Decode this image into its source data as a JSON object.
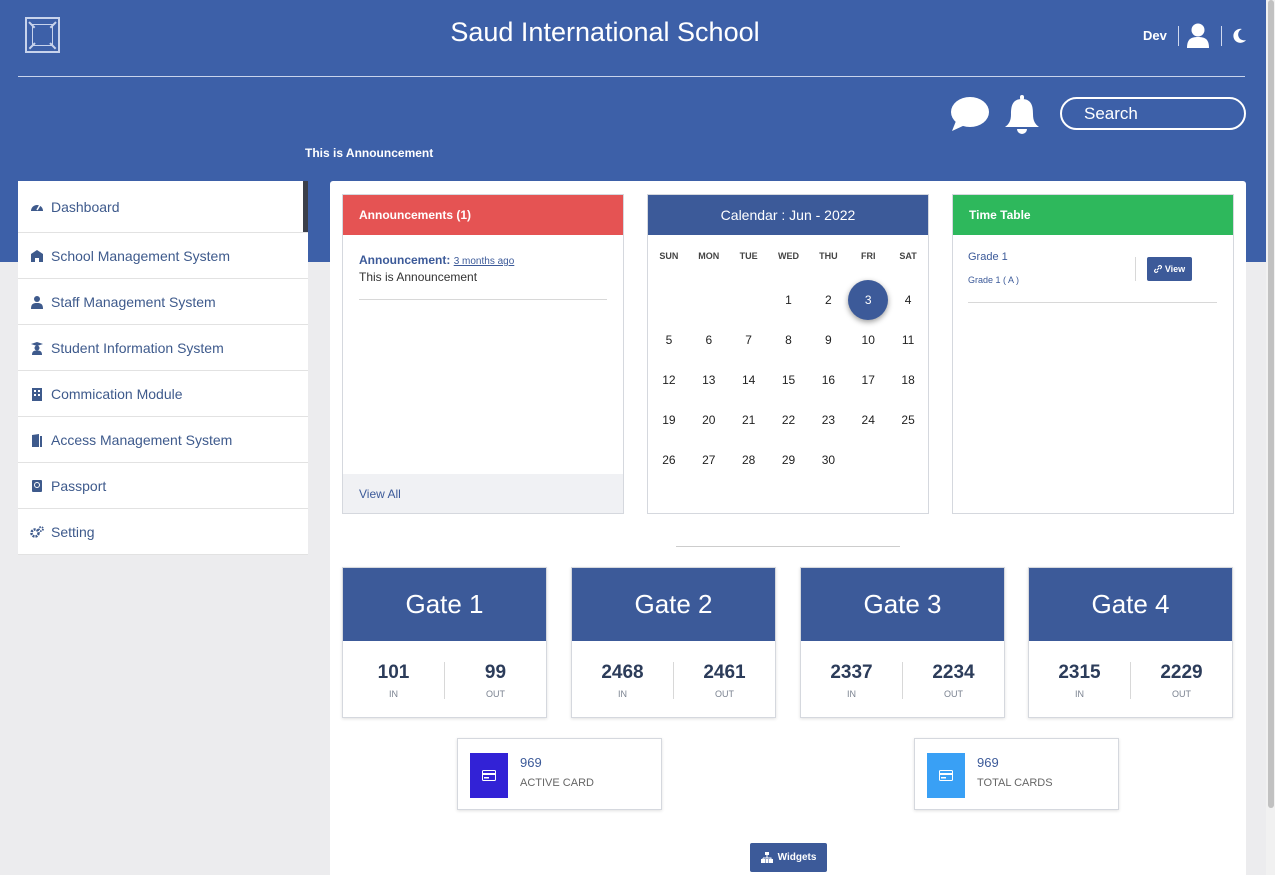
{
  "header": {
    "title": "Saud International School",
    "user_name": "Dev",
    "search_placeholder": "Search",
    "announcement_text": "This is Announcement",
    "icons": [
      "logo-icon",
      "user-icon",
      "moon-icon",
      "chat-icon",
      "bell-icon"
    ],
    "colors": {
      "header_bg": "#3d60a8"
    }
  },
  "sidebar": {
    "items": [
      {
        "label": "Dashboard",
        "icon": "dashboard-icon"
      },
      {
        "label": "School Management System",
        "icon": "school-icon"
      },
      {
        "label": "Staff Management System",
        "icon": "staff-icon"
      },
      {
        "label": "Student Information System",
        "icon": "student-icon"
      },
      {
        "label": "Commication Module",
        "icon": "building-icon"
      },
      {
        "label": "Access Management System",
        "icon": "door-icon"
      },
      {
        "label": "Passport",
        "icon": "passport-icon"
      },
      {
        "label": "Setting",
        "icon": "gears-icon"
      }
    ]
  },
  "announcements": {
    "header": "Announcements (1)",
    "label": "Announcement:",
    "time": "3 months ago",
    "message": "This is Announcement",
    "view_all": "View All",
    "color": "#e55353"
  },
  "calendar": {
    "header": "Calendar : Jun - 2022",
    "days": [
      "SUN",
      "MON",
      "TUE",
      "WED",
      "THU",
      "FRI",
      "SAT"
    ],
    "weeks": [
      [
        "",
        "",
        "",
        "1",
        "2",
        "3",
        "4"
      ],
      [
        "5",
        "6",
        "7",
        "8",
        "9",
        "10",
        "11"
      ],
      [
        "12",
        "13",
        "14",
        "15",
        "16",
        "17",
        "18"
      ],
      [
        "19",
        "20",
        "21",
        "22",
        "23",
        "24",
        "25"
      ],
      [
        "26",
        "27",
        "28",
        "29",
        "30",
        "",
        ""
      ]
    ],
    "today": "3"
  },
  "timetable": {
    "header": "Time Table",
    "grade": "Grade 1",
    "section": "Grade 1 ( A )",
    "view_label": "View",
    "color": "#2eb85c"
  },
  "gates": [
    {
      "name": "Gate 1",
      "in": "101",
      "out": "99"
    },
    {
      "name": "Gate 2",
      "in": "2468",
      "out": "2461"
    },
    {
      "name": "Gate 3",
      "in": "2337",
      "out": "2234"
    },
    {
      "name": "Gate 4",
      "in": "2315",
      "out": "2229"
    }
  ],
  "gate_labels": {
    "in": "IN",
    "out": "OUT"
  },
  "stats": [
    {
      "value": "969",
      "label": "ACTIVE CARD",
      "color": "#3222d6"
    },
    {
      "value": "969",
      "label": "TOTAL CARDS",
      "color": "#39a0f5"
    }
  ],
  "widgets_label": "Widgets"
}
